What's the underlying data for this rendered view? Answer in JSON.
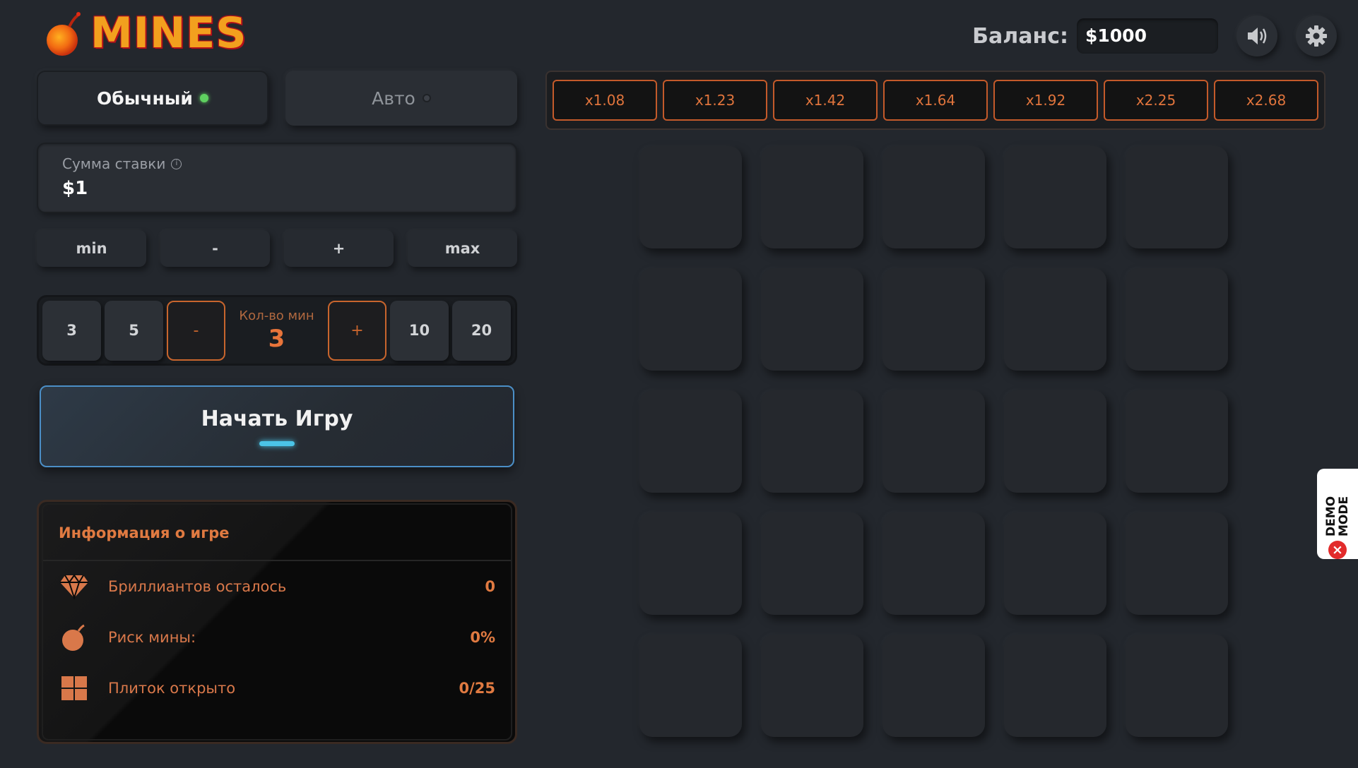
{
  "header": {
    "logo_text": "MINES",
    "balance_label": "Баланс:",
    "balance_value": "$1000",
    "sound_icon": "speaker-icon",
    "settings_icon": "gear-icon"
  },
  "modes": {
    "normal_label": "Обычный",
    "auto_label": "Авто",
    "active": "normal"
  },
  "bet": {
    "label": "Сумма ставки",
    "value": "$1"
  },
  "bet_adjust": {
    "min": "min",
    "minus": "-",
    "plus": "+",
    "max": "max"
  },
  "mines_selector": {
    "options_left": [
      "3",
      "5"
    ],
    "minus": "-",
    "label": "Кол-во мин",
    "value": "3",
    "plus": "+",
    "options_right": [
      "10",
      "20"
    ]
  },
  "start_button": {
    "label": "Начать Игру"
  },
  "info": {
    "title": "Информация о игре",
    "rows": [
      {
        "icon": "diamond-icon",
        "label": "Бриллиантов осталось",
        "value": "0"
      },
      {
        "icon": "bomb-icon",
        "label": "Риск мины:",
        "value": "0%"
      },
      {
        "icon": "tiles-icon",
        "label": "Плиток открыто",
        "value": "0/25"
      }
    ]
  },
  "multipliers": [
    "x1.08",
    "x1.23",
    "x1.42",
    "x1.64",
    "x1.92",
    "x2.25",
    "x2.68"
  ],
  "grid": {
    "rows": 5,
    "cols": 5
  },
  "demo_badge": {
    "text": "DEMO MODE"
  },
  "colors": {
    "accent": "#e0743c",
    "background": "#23272d",
    "start_border": "#4b8fc7",
    "active_dot": "#5fd160"
  }
}
